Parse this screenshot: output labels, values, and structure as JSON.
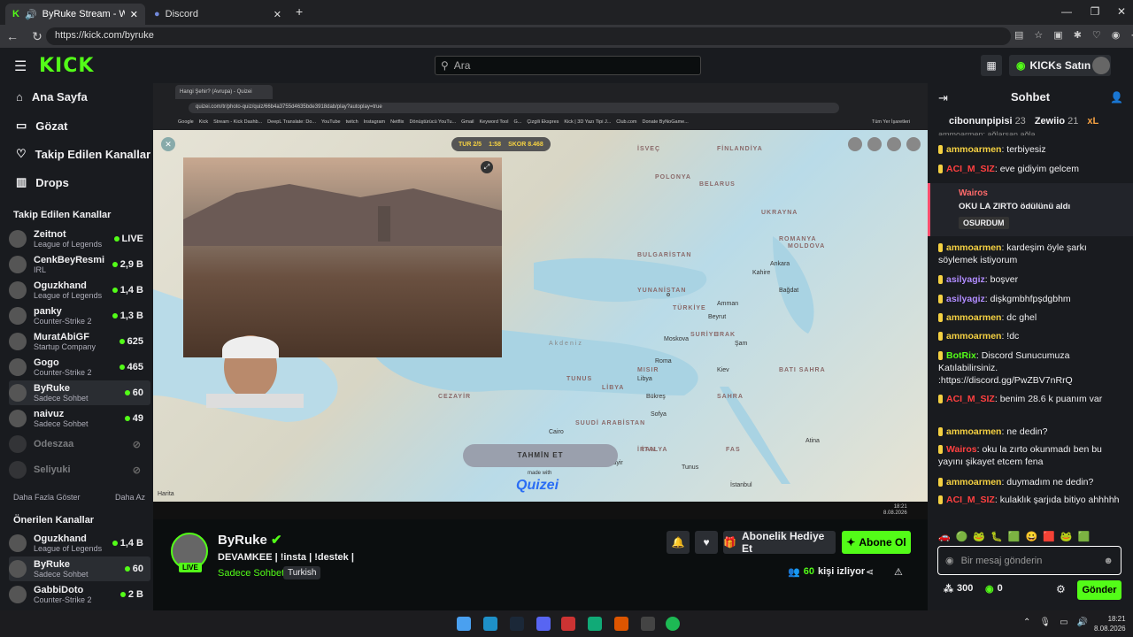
{
  "browser": {
    "tabs": [
      {
        "label": "ByRuke Stream - Watch Live o"
      },
      {
        "label": "Discord"
      }
    ],
    "url": "https://kick.com/byruke"
  },
  "header": {
    "search_placeholder": "Ara",
    "kicks_label": "KICKs Satın Al",
    "logo": "KICK"
  },
  "sidebar": {
    "nav": [
      "Ana Sayfa",
      "Gözat",
      "Takip Edilen Kanallar",
      "Drops"
    ],
    "followed_title": "Takip Edilen Kanallar",
    "followed": [
      {
        "name": "Zeitnot",
        "sub": "League of Legends",
        "val": "LIVE"
      },
      {
        "name": "CenkBeyResmi",
        "sub": "IRL",
        "val": "2,9 B"
      },
      {
        "name": "Oguzkhand",
        "sub": "League of Legends",
        "val": "1,4 B"
      },
      {
        "name": "panky",
        "sub": "Counter-Strike 2",
        "val": "1,3 B"
      },
      {
        "name": "MuratAbiGF",
        "sub": "Startup Company",
        "val": "625"
      },
      {
        "name": "Gogo",
        "sub": "Counter-Strike 2",
        "val": "465"
      },
      {
        "name": "ByRuke",
        "sub": "Sadece Sohbet",
        "val": "60"
      },
      {
        "name": "naivuz",
        "sub": "Sadece Sohbet",
        "val": "49"
      },
      {
        "name": "Odeszaa",
        "sub": "",
        "val": ""
      },
      {
        "name": "Seliyuki",
        "sub": "",
        "val": ""
      }
    ],
    "more": "Daha Fazla Göster",
    "less": "Daha Az",
    "recommended_title": "Önerilen Kanallar",
    "recommended": [
      {
        "name": "Oguzkhand",
        "sub": "League of Legends",
        "val": "1,4 B"
      },
      {
        "name": "ByRuke",
        "sub": "Sadece Sohbet",
        "val": "60"
      },
      {
        "name": "GabbiDoto",
        "sub": "Counter-Strike 2",
        "val": "2 B"
      }
    ]
  },
  "stream": {
    "inner_tab": "Hangi Şehir? (Avrupa) - Quizei",
    "inner_url": "quizei.com/tr/photo-quiz/quiz/66b4a3755d4635bde3918dab/play?autoplay=true",
    "bookmarks": [
      "Google",
      "Kick",
      "Stream - Kick Dashb...",
      "DeepL Translate: Do...",
      "YouTube",
      "twitch",
      "Instagram",
      "Netflix",
      "Dönüştürücü YouTu...",
      "Gmail",
      "Keyword Tool",
      "G...",
      "Çizgili Ekspres",
      "Kick | 3D Yazı Tipi J...",
      "Club.com",
      "Donate ByNoGame..."
    ],
    "bookmarks_right": "Tüm Yer İşaretleri",
    "quiz_tur": "TUR 2/5",
    "quiz_time": "1:58",
    "quiz_skor": "SKOR 8.468",
    "guess_button": "TAHMİN ET",
    "brand": "Quizei",
    "made_with": "made with",
    "map_credit": "Harita",
    "clock": "18:21",
    "date": "8.08.2026",
    "map_labels": [
      "FİNLANDİYA",
      "İSVEÇ",
      "POLONYA",
      "BELARUS",
      "UKRAYNA",
      "ROMANYA",
      "MOLDOVA",
      "BULGARİSTAN",
      "YUNANİSTAN",
      "TÜRKİYE",
      "SURİYE",
      "IRAK",
      "MISIR",
      "LİBYA",
      "TUNUS",
      "CEZAYİR",
      "SUUDİ ARABİSTAN",
      "İRAN",
      "İTALYA",
      "FAS",
      "BATI SAHRA",
      "SAHRA",
      "Cairo",
      "İstanbul",
      "Ankara",
      "Kahire",
      "Bağdat",
      "Amman",
      "Beyrut",
      "Şam",
      "Kiev",
      "Moskova",
      "Bükreş",
      "Sofya",
      "Atina",
      "Roma",
      "Tunus",
      "Cezayir",
      "Libya"
    ],
    "map_sea": "Akdeniz"
  },
  "streamer": {
    "name": "ByRuke",
    "title": "DEVAMKEE | !insta | !destek |",
    "category": "Sadece Sohbet",
    "language": "Turkish",
    "live_badge": "LIVE",
    "viewers": "60",
    "viewers_label": "kişi izliyor",
    "gift_label": "Abonelik Hediye Et",
    "sub_label": "Abone Ol"
  },
  "chat": {
    "title": "Sohbet",
    "top": [
      {
        "name": "cibonunpipisi",
        "val": "23"
      },
      {
        "name": "Zewiio",
        "val": "21"
      },
      {
        "name": "xL",
        "val": ""
      }
    ],
    "partial": "ammoarmen: ağlarsan ağla",
    "messages": [
      {
        "user": "ammoarmen",
        "text": "terbiyesiz",
        "color": "ug"
      },
      {
        "user": "ACI_M_SIZ",
        "text": "eve gidiyim gelcem",
        "color": "ur"
      },
      {
        "user": "ammoarmen",
        "text": "kardeşim öyle şarkı söylemek istiyorum",
        "color": "ug"
      },
      {
        "user": "asilyagiz",
        "text": "boşver",
        "color": "up"
      },
      {
        "user": "asilyagiz",
        "text": "dişkgmbhfpşdgbhm",
        "color": "up"
      },
      {
        "user": "ammoarmen",
        "text": "dc ghel",
        "color": "ug"
      },
      {
        "user": "ammoarmen",
        "text": "!dc",
        "color": "ug"
      },
      {
        "user": "BotRix",
        "text": "Discord Sunucumuza Katılabilirsiniz. :https://discord.gg/PwZBV7nRrQ",
        "color": "ub"
      },
      {
        "user": "ACI_M_SIZ",
        "text": "benim 28.6 k puanım var",
        "color": "ur"
      },
      {
        "user": "ammoarmen",
        "text": "ne dedin?",
        "color": "ug"
      },
      {
        "user": "Wairos",
        "text": "oku la zırto okunmadı ben bu yayını şikayet etcem fena",
        "color": "ur"
      },
      {
        "user": "ammoarmen",
        "text": "duymadım ne dedin?",
        "color": "ug"
      },
      {
        "user": "ACI_M_SIZ",
        "text": "kulaklık şarjıda bitiyo ahhhhh",
        "color": "ur"
      }
    ],
    "reward": {
      "user": "Wairos",
      "text": "OKU LA ZIRTO ödülünü aldı",
      "tag": "OSURDUM"
    },
    "placeholder": "Bir mesaj gönderin",
    "points": "300",
    "kicks": "0",
    "send": "Gönder"
  },
  "os": {
    "time": "18:21",
    "date": "8.08.2026"
  },
  "colors": {
    "accent": "#53fc18",
    "bg": "#0b0e0f",
    "panel": "#191b1f"
  }
}
